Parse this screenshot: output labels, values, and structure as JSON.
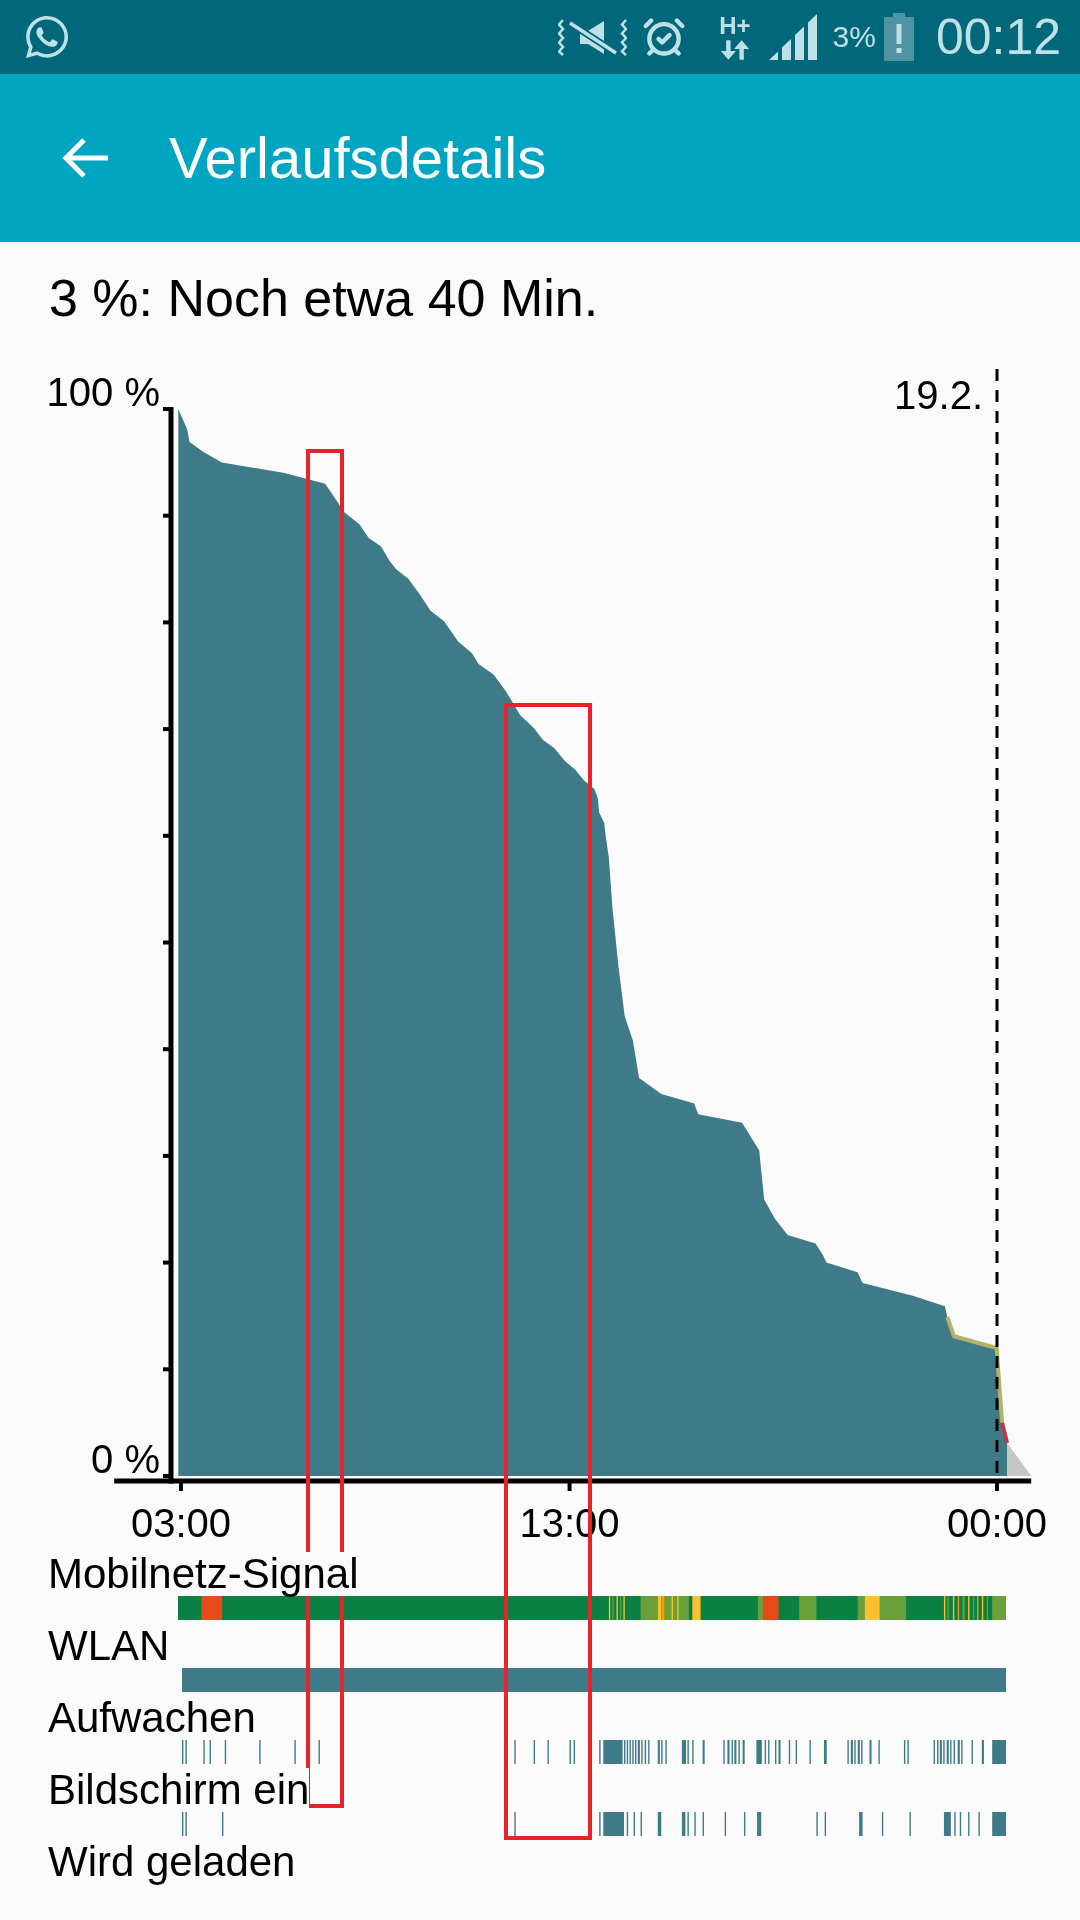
{
  "status_bar": {
    "network": "H+",
    "battery": "3%",
    "time": "00:12"
  },
  "app_bar": {
    "title": "Verlaufsdetails"
  },
  "summary": "3 %: Noch etwa 40 Min.",
  "battery_chart": {
    "chart_data": {
      "type": "area",
      "x": [
        2.93,
        3.16,
        3.22,
        3.57,
        4.05,
        5.66,
        6.71,
        7.21,
        7.59,
        7.83,
        8.15,
        8.36,
        8.53,
        8.85,
        9.15,
        9.42,
        9.77,
        10.13,
        10.49,
        10.66,
        11.05,
        11.37,
        11.73,
        12.08,
        12.31,
        12.61,
        12.88,
        13.14,
        13.37,
        13.64,
        13.73,
        13.76,
        13.89,
        13.94,
        14.01,
        14.1,
        14.26,
        14.42,
        14.63,
        14.79,
        15.36,
        16.21,
        16.31,
        17.44,
        17.88,
        18.01,
        18.29,
        18.61,
        19.33,
        19.52,
        19.61,
        20.41,
        20.54,
        21.83,
        22.66,
        22.72,
        22.89,
        23.99,
        24.13,
        24.26,
        24.88
      ],
      "series": [
        {
          "type": "area",
          "color": "#3f7a88",
          "values": [
            100,
            98.1,
            96.9,
            96,
            95,
            94,
            93,
            90.3,
            89.2,
            87.9,
            87.1,
            85.8,
            85,
            84.1,
            82.6,
            81.1,
            80.1,
            78.2,
            77.1,
            76.1,
            75.1,
            73.5,
            71.3,
            70.1,
            69,
            68.2,
            67,
            66.2,
            65.2,
            64.4,
            63.5,
            62.2,
            61.2,
            59.7,
            58,
            53.4,
            47.7,
            43.1,
            40.8,
            37.3,
            35.8,
            34.9,
            33.9,
            33.1,
            30.5,
            25.9,
            24.1,
            22.6,
            21.8,
            20.7,
            20,
            19.1,
            18.1,
            16.9,
            15.9,
            14.9,
            13.1,
            12,
            5,
            3.1,
            null
          ]
        },
        {
          "type": "line",
          "color": "#b3b16a",
          "values": [
            null,
            null,
            null,
            null,
            null,
            null,
            null,
            null,
            null,
            null,
            null,
            null,
            null,
            null,
            null,
            null,
            null,
            null,
            null,
            null,
            null,
            null,
            null,
            null,
            null,
            null,
            null,
            null,
            null,
            null,
            null,
            null,
            null,
            null,
            null,
            null,
            null,
            null,
            null,
            null,
            null,
            null,
            null,
            null,
            null,
            null,
            null,
            null,
            null,
            null,
            null,
            null,
            null,
            null,
            null,
            14.9,
            13.1,
            12,
            5,
            null,
            null
          ]
        },
        {
          "type": "line",
          "color": "#b43a4a",
          "values": [
            null,
            null,
            null,
            null,
            null,
            null,
            null,
            null,
            null,
            null,
            null,
            null,
            null,
            null,
            null,
            null,
            null,
            null,
            null,
            null,
            null,
            null,
            null,
            null,
            null,
            null,
            null,
            null,
            null,
            null,
            null,
            null,
            null,
            null,
            null,
            null,
            null,
            null,
            null,
            null,
            null,
            null,
            null,
            null,
            null,
            null,
            null,
            null,
            null,
            null,
            null,
            null,
            null,
            null,
            null,
            null,
            null,
            null,
            5,
            3.1,
            null
          ]
        },
        {
          "type": "area",
          "color": "#c6c6c6",
          "values": [
            null,
            null,
            null,
            null,
            null,
            null,
            null,
            null,
            null,
            null,
            null,
            null,
            null,
            null,
            null,
            null,
            null,
            null,
            null,
            null,
            null,
            null,
            null,
            null,
            null,
            null,
            null,
            null,
            null,
            null,
            null,
            null,
            null,
            null,
            null,
            null,
            null,
            null,
            null,
            null,
            null,
            null,
            null,
            null,
            null,
            null,
            null,
            null,
            null,
            null,
            null,
            null,
            null,
            null,
            null,
            null,
            null,
            null,
            null,
            3.1,
            0
          ]
        }
      ],
      "xlim": [
        1.28,
        24.88
      ],
      "ylim": [
        0,
        100
      ],
      "xticks": [
        {
          "value": 3,
          "label": "03:00"
        },
        {
          "value": 13,
          "label": "13:00"
        },
        {
          "value": 24,
          "label": "00:00"
        }
      ],
      "yticks": [
        {
          "value": 0,
          "label": "0 %"
        },
        {
          "value": 100,
          "label": "100 %"
        }
      ],
      "ref_lines": [
        {
          "axis": "x",
          "value": 24
        }
      ],
      "annotations": [
        {
          "x": 24,
          "y": 100,
          "text": "19.2."
        }
      ]
    }
  },
  "highlight_frames": [
    {
      "kind": "outline"
    },
    {
      "kind": "outline"
    }
  ],
  "timelines": [
    {
      "label": "Mobilnetz-Signal",
      "kind": "signal"
    },
    {
      "label": "WLAN",
      "kind": "wifi"
    },
    {
      "label": "Aufwachen",
      "kind": "wakeup"
    },
    {
      "label": "Bildschirm ein",
      "kind": "screen"
    },
    {
      "label": "Wird geladen",
      "kind": "charging"
    }
  ]
}
